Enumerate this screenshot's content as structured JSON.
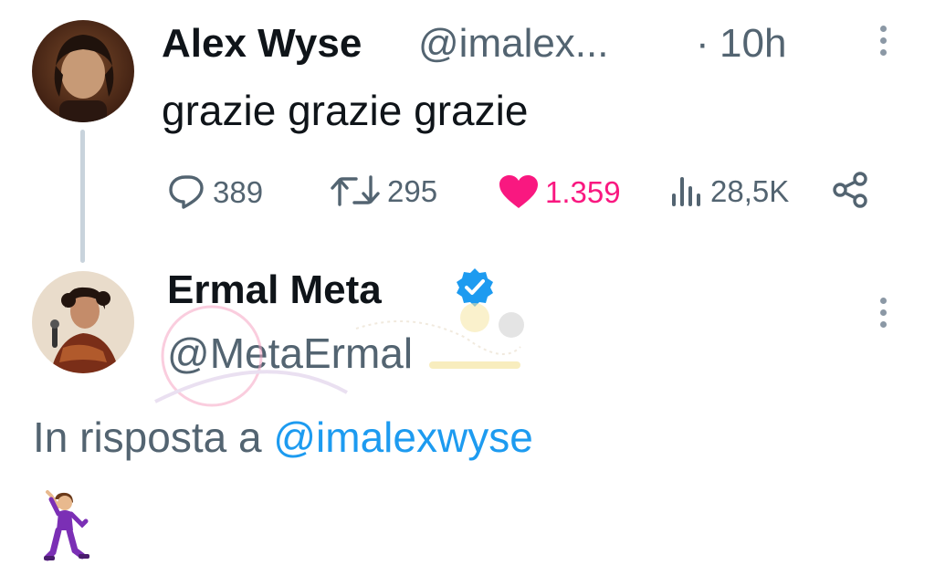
{
  "tweet1": {
    "author_name": "Alex Wyse",
    "handle": "@imalex...",
    "separator": "·",
    "time": "10h",
    "text": "grazie grazie grazie",
    "actions": {
      "replies": "389",
      "retweets": "295",
      "likes": "1.359",
      "views": "28,5K"
    },
    "liked": true
  },
  "tweet2": {
    "author_name": "Ermal Meta",
    "verified": true,
    "handle": "@MetaErmal",
    "reply_prefix": "In risposta a ",
    "reply_mention": "@imalexwyse",
    "content_emoji": "dancer-emoji"
  },
  "colors": {
    "text": "#0f1419",
    "secondary": "#536471",
    "like": "#f91880",
    "link": "#1d9bf0",
    "verified": "#1d9bf0",
    "thread_line": "#c8d3dc"
  },
  "icons": [
    "more-icon",
    "reply-icon",
    "retweet-icon",
    "like-icon",
    "views-icon",
    "share-icon",
    "verified-badge-icon"
  ]
}
